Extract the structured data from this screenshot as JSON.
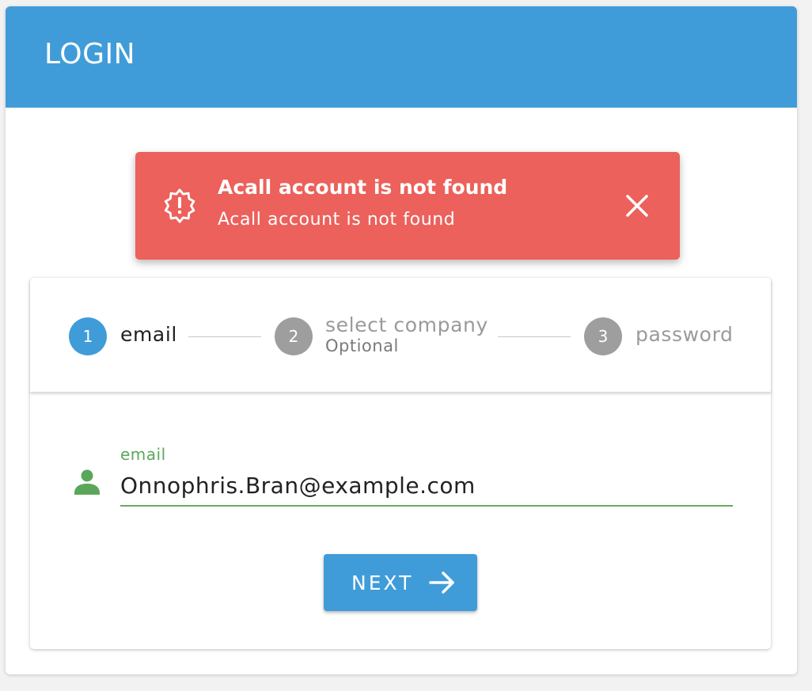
{
  "header": {
    "title": "LOGIN"
  },
  "alert": {
    "title": "Acall account is not found",
    "message": "Acall account is not found",
    "icon": "alert-decagram-icon",
    "close_icon": "close-icon",
    "color": "#ec615b"
  },
  "stepper": {
    "steps": [
      {
        "number": "1",
        "label": "email",
        "sublabel": "",
        "state": "active"
      },
      {
        "number": "2",
        "label": "select company",
        "sublabel": "Optional",
        "state": "inactive"
      },
      {
        "number": "3",
        "label": "password",
        "sublabel": "",
        "state": "inactive"
      }
    ]
  },
  "form": {
    "email": {
      "label": "email",
      "value": "Onnophris.Bran@example.com",
      "icon": "person-icon"
    },
    "next_button": {
      "label": "NEXT",
      "icon": "arrow-right-icon"
    }
  },
  "colors": {
    "primary": "#409cd9",
    "error": "#ec615b",
    "success": "#5aa75a",
    "inactive": "#9e9e9e"
  }
}
